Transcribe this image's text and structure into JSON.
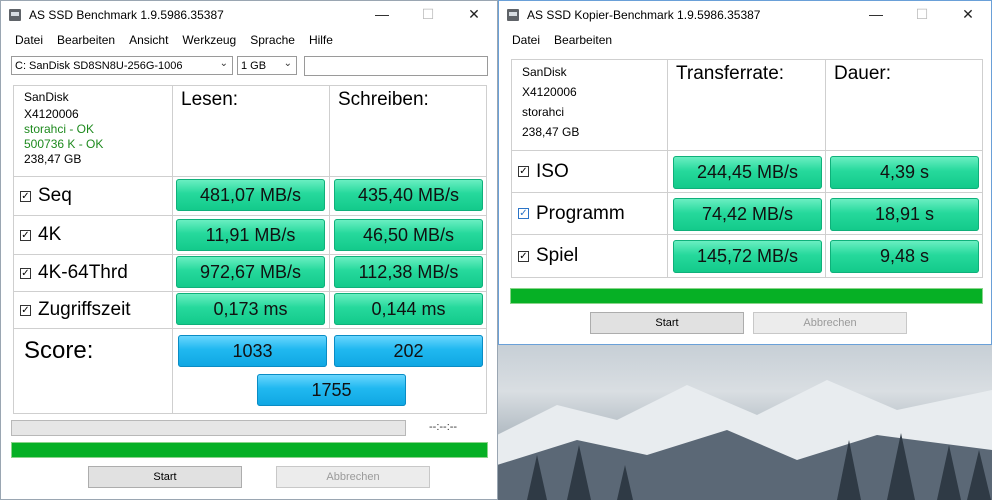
{
  "main_window": {
    "title": "AS SSD Benchmark 1.9.5986.35387",
    "menu": [
      "Datei",
      "Bearbeiten",
      "Ansicht",
      "Werkzeug",
      "Sprache",
      "Hilfe"
    ],
    "drive_select": "C: SanDisk SD8SN8U-256G-1006",
    "size_select": "1 GB",
    "info": {
      "vendor": "SanDisk",
      "firmware": "X4120006",
      "driver": "storahci - OK",
      "alignment": "500736 K - OK",
      "capacity": "238,47 GB"
    },
    "headers": {
      "read": "Lesen:",
      "write": "Schreiben:"
    },
    "rows": [
      {
        "label": "Seq",
        "read": "481,07 MB/s",
        "write": "435,40 MB/s"
      },
      {
        "label": "4K",
        "read": "11,91 MB/s",
        "write": "46,50 MB/s"
      },
      {
        "label": "4K-64Thrd",
        "read": "972,67 MB/s",
        "write": "112,38 MB/s"
      },
      {
        "label": "Zugriffszeit",
        "read": "0,173 ms",
        "write": "0,144 ms"
      }
    ],
    "score": {
      "label": "Score:",
      "read": "1033",
      "write": "202",
      "total": "1755"
    },
    "timer": "--:--:--",
    "progress_full": 1.0,
    "buttons": {
      "start": "Start",
      "abort": "Abbrechen"
    }
  },
  "copy_window": {
    "title": "AS SSD Kopier-Benchmark 1.9.5986.35387",
    "menu": [
      "Datei",
      "Bearbeiten"
    ],
    "info": {
      "vendor": "SanDisk",
      "firmware": "X4120006",
      "driver": "storahci",
      "capacity": "238,47 GB"
    },
    "headers": {
      "rate": "Transferrate:",
      "duration": "Dauer:"
    },
    "rows": [
      {
        "label": "ISO",
        "rate": "244,45 MB/s",
        "duration": "4,39 s"
      },
      {
        "label": "Programm",
        "rate": "74,42 MB/s",
        "duration": "18,91 s"
      },
      {
        "label": "Spiel",
        "rate": "145,72 MB/s",
        "duration": "9,48 s"
      }
    ],
    "progress_full": 1.0,
    "buttons": {
      "start": "Start",
      "abort": "Abbrechen"
    }
  },
  "colors": {
    "result_green": "#26d99c",
    "score_blue": "#20b8f0",
    "progress_green": "#06b025"
  },
  "icons": [
    "minimize-icon",
    "maximize-icon",
    "close-icon",
    "checkbox-checked-icon",
    "chevron-down-icon"
  ]
}
